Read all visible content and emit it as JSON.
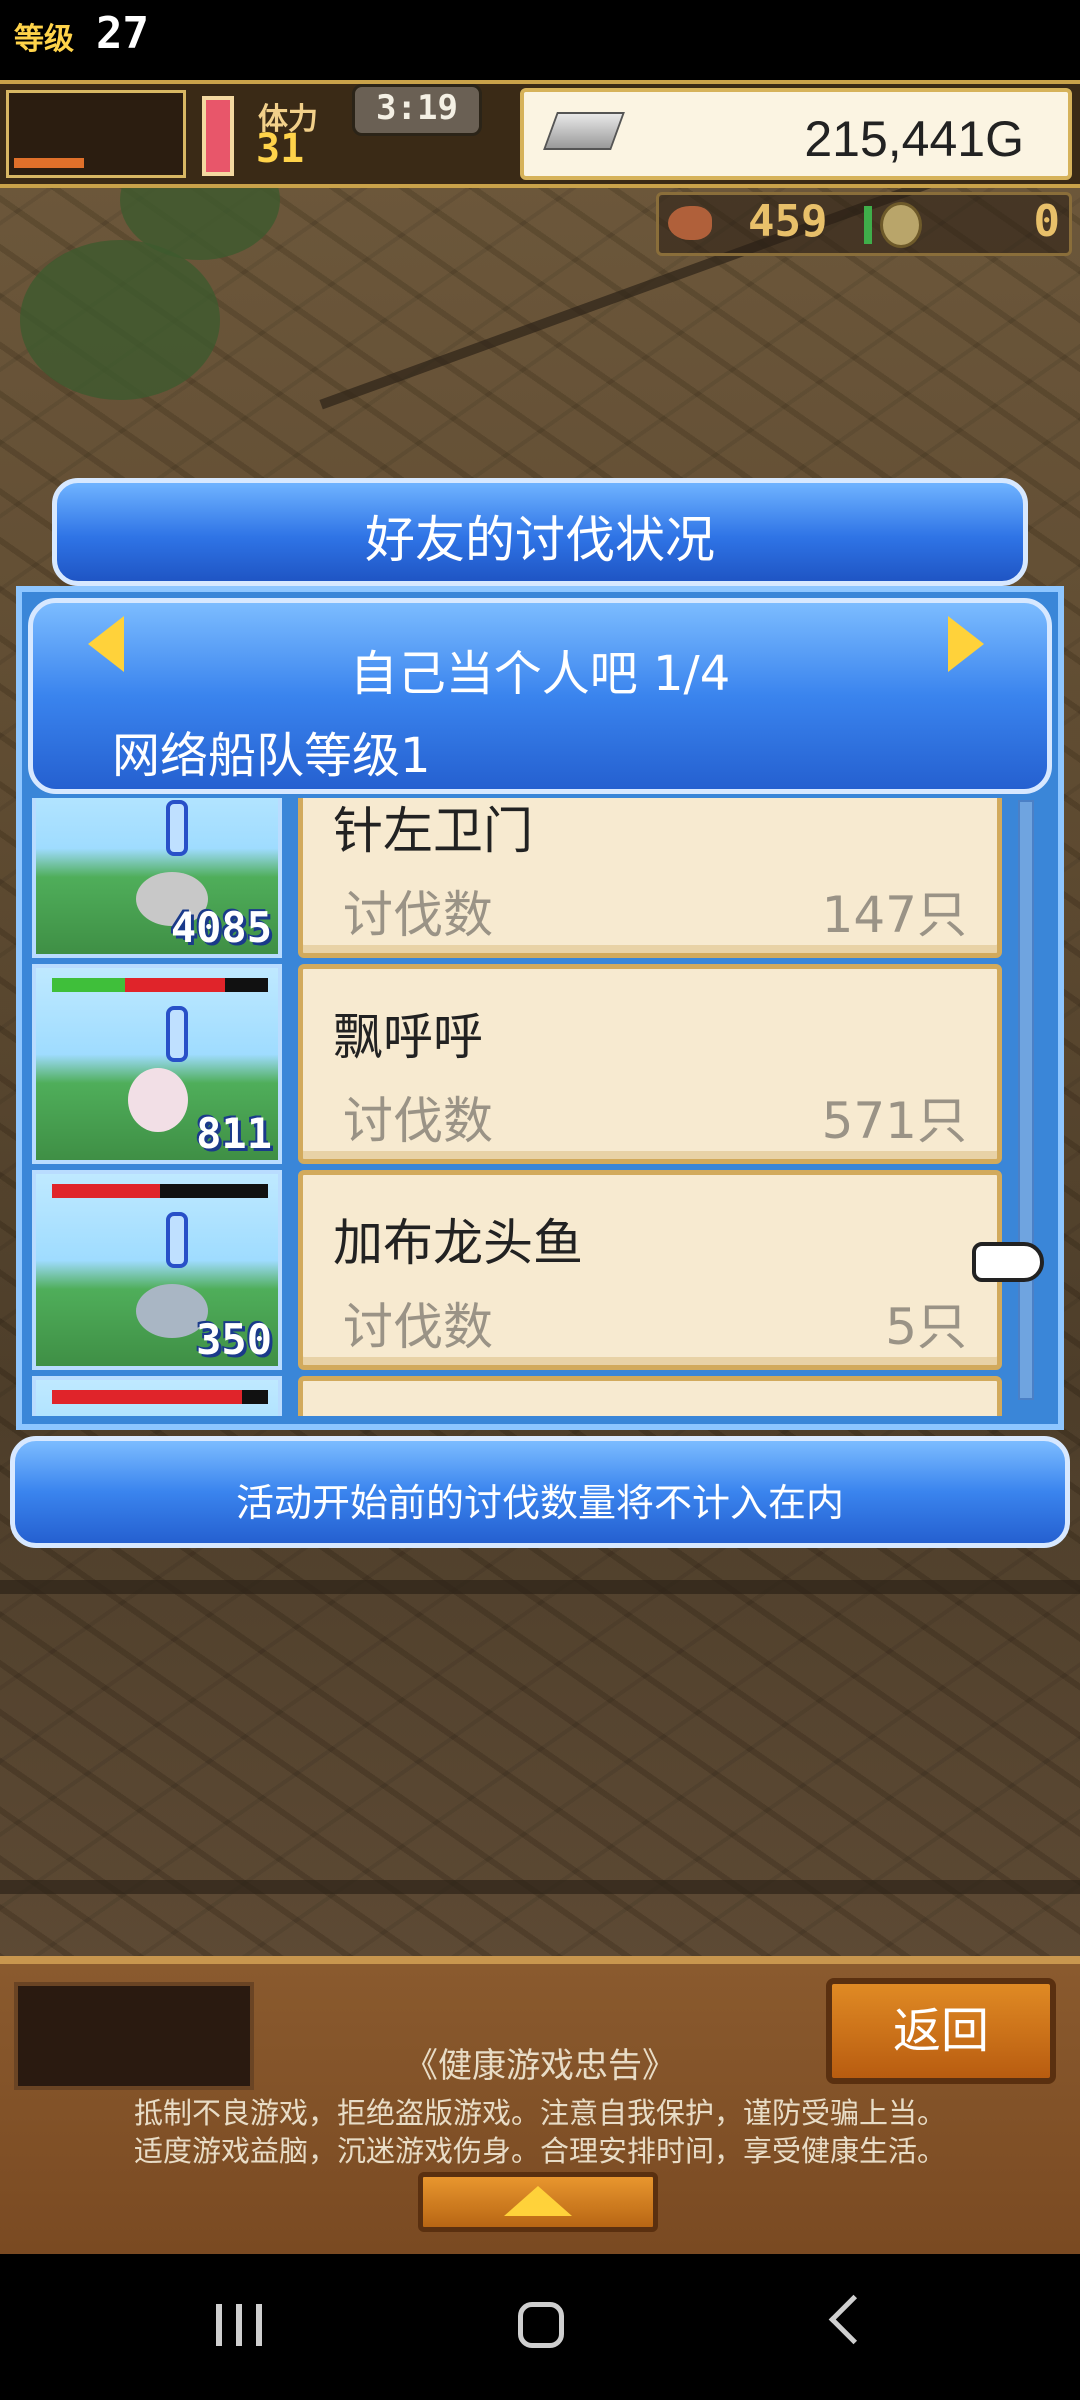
{
  "hud": {
    "level_label": "等级",
    "level": "27",
    "stamina_label": "体力",
    "stamina": "31",
    "timer": "3:19",
    "money": "215,441G",
    "resource_1": "459",
    "resource_2": "0"
  },
  "dialog": {
    "title": "好友的讨伐状况",
    "friend_name": "自己当个人吧 1/4",
    "fleet_level": "网络船队等级1",
    "notice": "活动开始前的讨伐数量将不计入在内"
  },
  "rows": [
    {
      "name": "针左卫门",
      "label": "讨伐数",
      "count": "147只",
      "thumb_number": "4085",
      "hp_red": 0,
      "hp_green": 0
    },
    {
      "name": "飘呼呼",
      "label": "讨伐数",
      "count": "571只",
      "thumb_number": "811",
      "hp_red": 0.46,
      "hp_green": 0.34
    },
    {
      "name": "加布龙头鱼",
      "label": "讨伐数",
      "count": "5只",
      "thumb_number": "350",
      "hp_red": 0.5,
      "hp_green": 0
    }
  ],
  "bottom": {
    "back_label": "返回",
    "advisory_title": "《健康游戏忠告》",
    "advisory_line1": "抵制不良游戏，拒绝盗版游戏。注意自我保护，谨防受骗上当。",
    "advisory_line2": "适度游戏益脑，沉迷游戏伤身。合理安排时间，享受健康生活。"
  },
  "icons": {
    "prev": "arrow-left-icon",
    "next": "arrow-right-icon",
    "cursor": "pointing-hand-icon",
    "expand": "arrow-up-icon"
  },
  "colors": {
    "dialog_blue": "#3a84ee",
    "card_beige": "#f7ead0",
    "gold_arrow": "#ffd23a"
  }
}
